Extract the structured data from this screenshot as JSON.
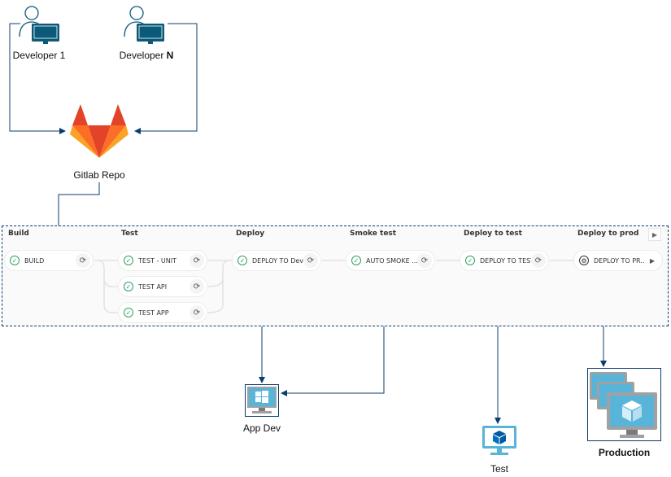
{
  "developers": [
    {
      "label": "Developer 1",
      "icon": "developer-workstation-icon"
    },
    {
      "label_prefix": "Developer ",
      "label_bold": "N",
      "icon": "developer-workstation-icon"
    }
  ],
  "repo": {
    "label": "Gitlab Repo",
    "icon": "gitlab-logo-icon"
  },
  "pipeline": {
    "stages": [
      {
        "title": "Build",
        "jobs": [
          {
            "name": "BUILD",
            "status": "success",
            "action": "retry"
          }
        ]
      },
      {
        "title": "Test",
        "jobs": [
          {
            "name": "TEST - UNIT",
            "status": "success",
            "action": "retry"
          },
          {
            "name": "TEST API",
            "status": "success",
            "action": "retry"
          },
          {
            "name": "TEST APP",
            "status": "success",
            "action": "retry"
          }
        ]
      },
      {
        "title": "Deploy",
        "jobs": [
          {
            "name": "DEPLOY TO Dev",
            "status": "success",
            "action": "retry"
          }
        ]
      },
      {
        "title": "Smoke test",
        "jobs": [
          {
            "name": "AUTO SMOKE ...",
            "status": "success",
            "action": "retry"
          }
        ]
      },
      {
        "title": "Deploy to test",
        "jobs": [
          {
            "name": "DEPLOY TO TEST",
            "status": "success",
            "action": "retry"
          }
        ]
      },
      {
        "title": "Deploy to prod",
        "jobs": [
          {
            "name": "DEPLOY TO PR...",
            "status": "manual",
            "action": "play"
          }
        ]
      }
    ],
    "glyphs": {
      "success": "✓",
      "manual": "⚙",
      "retry": "⟳",
      "play": "▶"
    }
  },
  "environments": [
    {
      "label": "App Dev",
      "icon": "windows-vm-icon"
    },
    {
      "label": "Test",
      "icon": "vm-cube-icon"
    },
    {
      "label": "Production",
      "icon": "vm-stack-icon"
    }
  ],
  "colors": {
    "connector": "#0b3c6e",
    "success": "#2da160",
    "vm_blue": "#59b4d9",
    "vm_grey": "#a0a1a2",
    "dev_icon": "#0b5a7a"
  }
}
